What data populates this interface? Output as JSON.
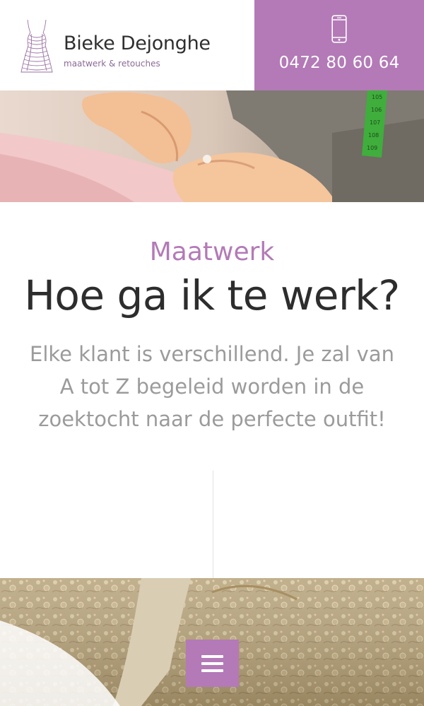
{
  "header": {
    "brand_name": "Bieke Dejonghe",
    "brand_tagline": "maatwerk & retouches",
    "logo_icon": "dress-logo-icon",
    "phone_icon": "smartphone-icon",
    "phone_number": "0472 80 60 64"
  },
  "hero": {
    "image": "sewing-hands-photo"
  },
  "content": {
    "kicker": "Maatwerk",
    "headline": "Hoe ga ik te werk?",
    "intro": "Elke klant is verschillend. Je zal van A tot Z begeleid worden in de zoektocht naar de perfecte outfit!"
  },
  "footer_image": {
    "image": "lace-fabric-photo"
  },
  "menu": {
    "icon": "hamburger-menu-icon"
  },
  "colors": {
    "accent": "#b37ab7",
    "heading": "#2d2d2d",
    "body_text": "#9b9b9b",
    "background": "#ffffff"
  }
}
